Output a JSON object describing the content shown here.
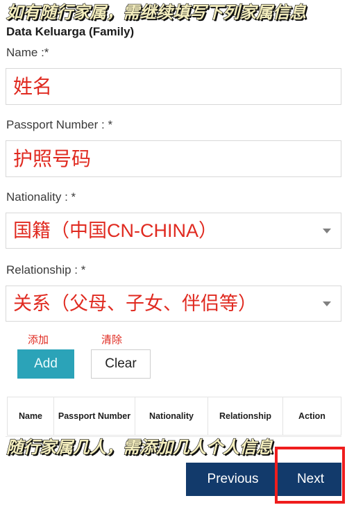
{
  "annotations": {
    "top": "如有随行家属，需继续填写下列家属信息",
    "bottom": "随行家属几人，需添加几人个人信息"
  },
  "section": {
    "title": "Data Keluarga (Family)"
  },
  "fields": [
    {
      "label": "Name :*",
      "value": "姓名",
      "type": "text",
      "name": "name"
    },
    {
      "label": "Passport Number : *",
      "value": "护照号码",
      "type": "text",
      "name": "passport-number"
    },
    {
      "label": "Nationality : *",
      "value": "国籍（中国CN-CHINA）",
      "type": "select",
      "name": "nationality"
    },
    {
      "label": "Relationship : *",
      "value": "关系（父母、子女、伴侣等）",
      "type": "select",
      "name": "relationship"
    }
  ],
  "actions": {
    "add_annotation": "添加",
    "add_label": "Add",
    "clear_annotation": "清除",
    "clear_label": "Clear"
  },
  "table": {
    "columns": [
      "Name",
      "Passport Number",
      "Nationality",
      "Relationship",
      "Action"
    ],
    "rows": []
  },
  "navigation": {
    "previous_label": "Previous",
    "next_label": "Next"
  },
  "icons": {
    "dropdown": "chevron-down-icon"
  },
  "colors": {
    "annotation_fill": "#f4eebe",
    "annotation_stroke": "#111111",
    "field_value_red": "#e02a20",
    "add_button_teal": "#2ba3b8",
    "nav_navy": "#123a6b",
    "highlight_red": "#ef1d1d"
  }
}
